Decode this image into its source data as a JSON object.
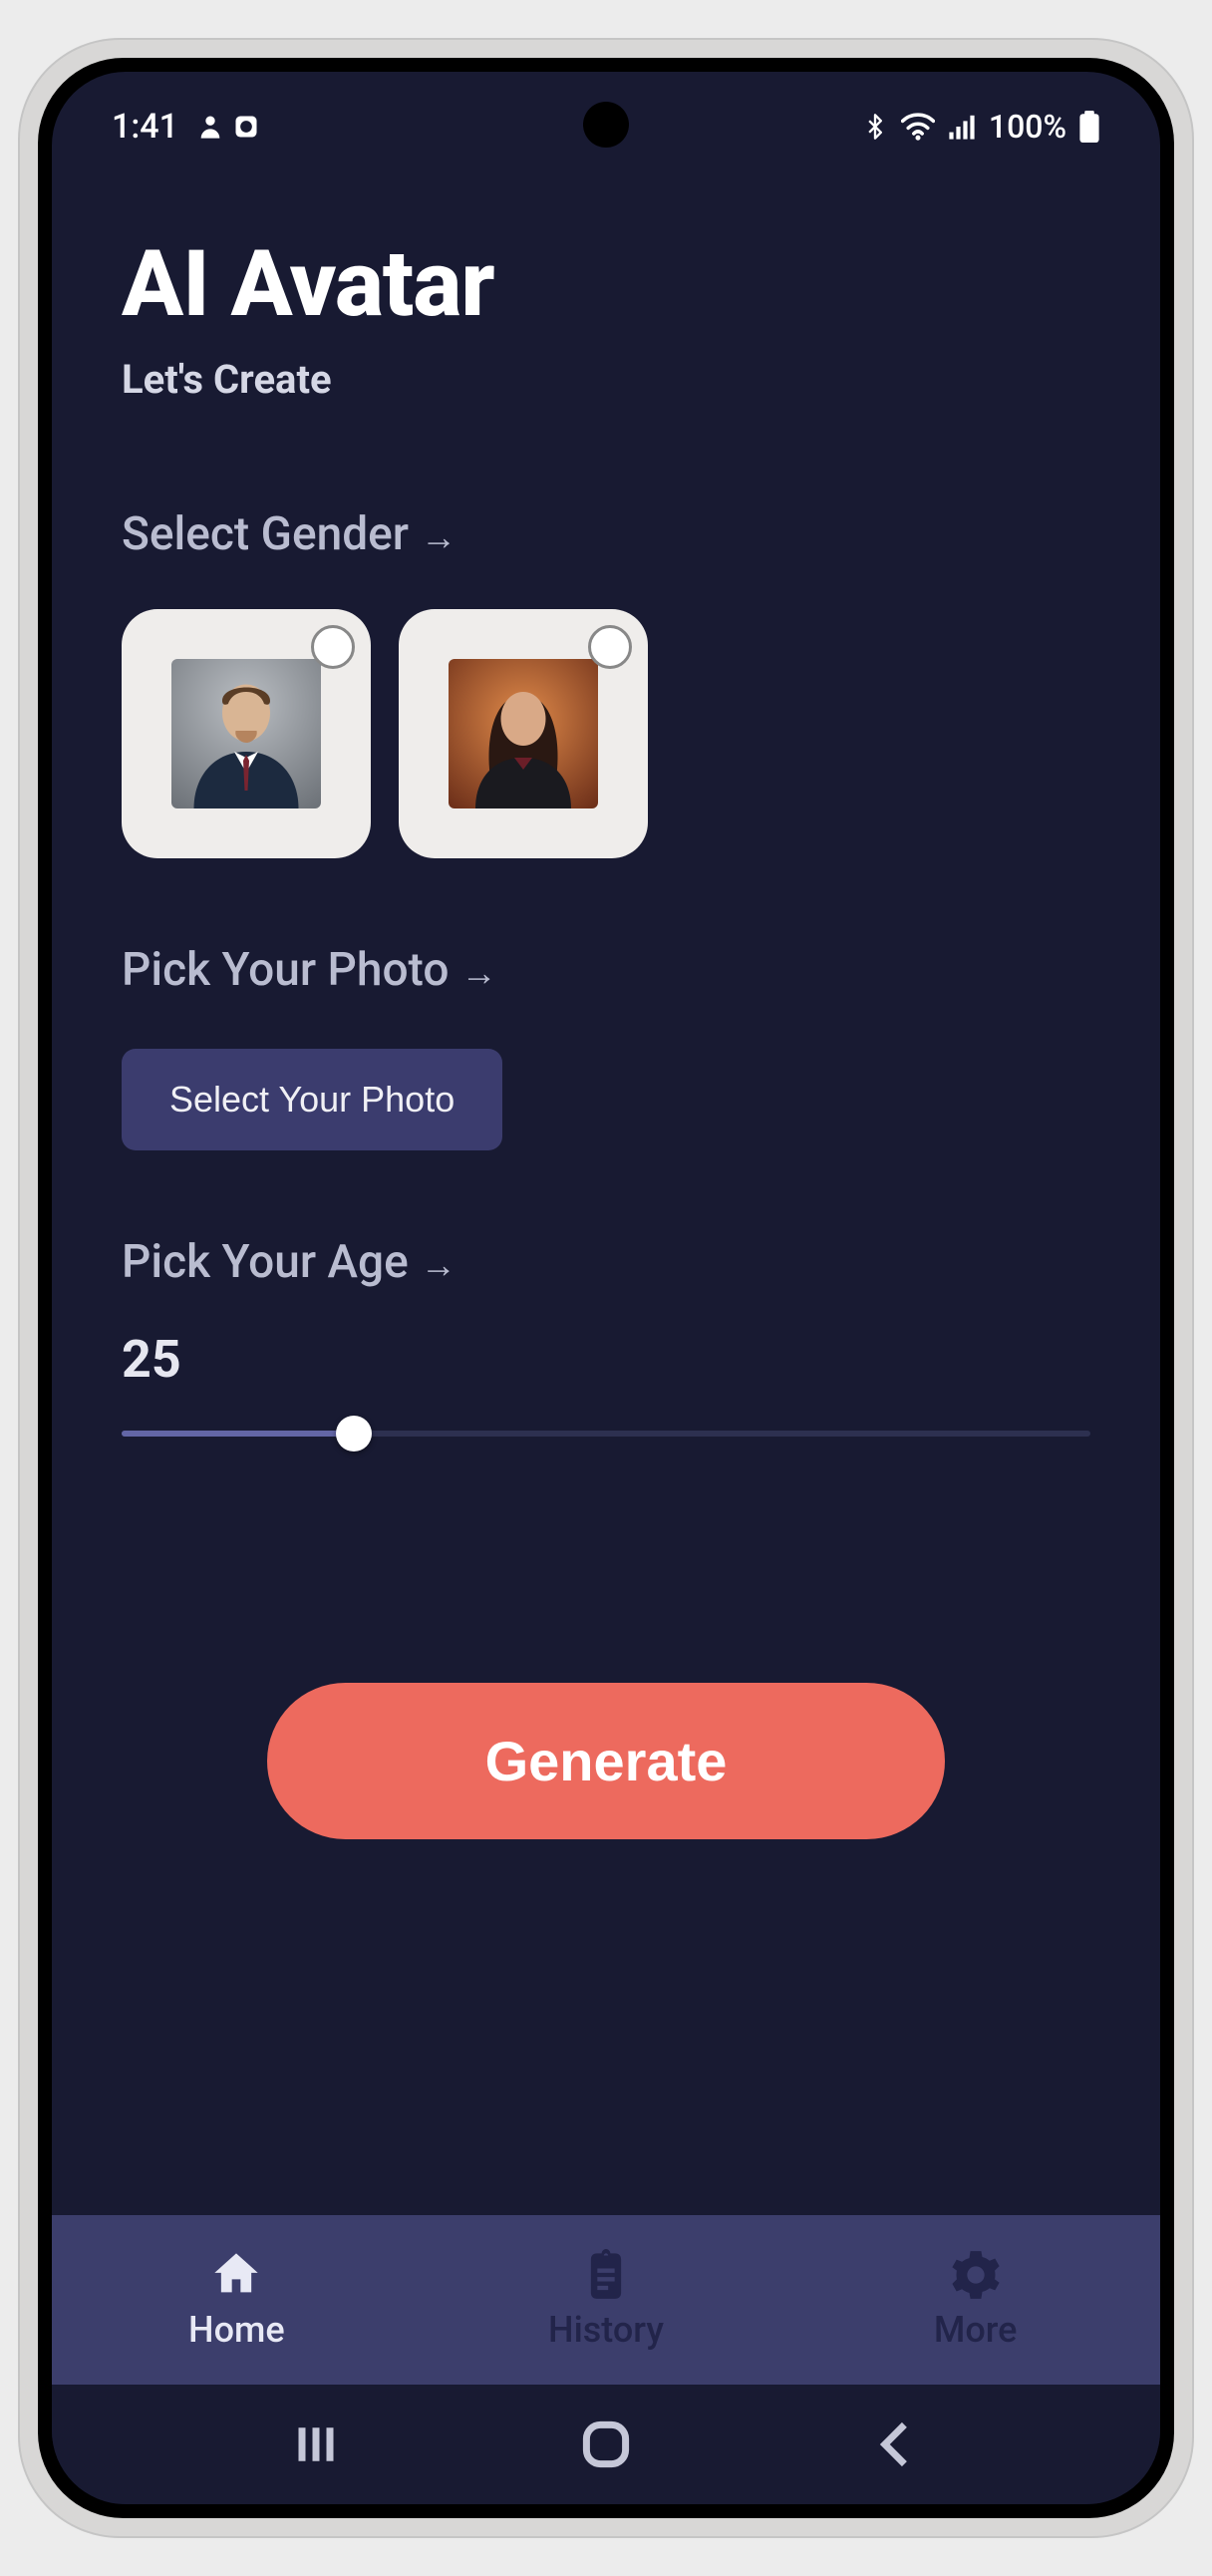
{
  "status": {
    "time": "1:41",
    "battery_text": "100%"
  },
  "header": {
    "title": "AI Avatar",
    "subtitle": "Let's Create"
  },
  "sections": {
    "gender_label": "Select Gender",
    "photo_label": "Pick Your Photo",
    "age_label": "Pick Your Age"
  },
  "gender_options": [
    {
      "id": "male",
      "selected": false
    },
    {
      "id": "female",
      "selected": false
    }
  ],
  "photo_button": "Select Your Photo",
  "age": {
    "value": "25",
    "percent": 24
  },
  "generate_button": "Generate",
  "nav": {
    "home": "Home",
    "history": "History",
    "more": "More"
  },
  "colors": {
    "background": "#181a32",
    "accent": "#ed6a5e",
    "secondary": "#3b3c6e",
    "nav_bg": "#3c3e6c"
  }
}
